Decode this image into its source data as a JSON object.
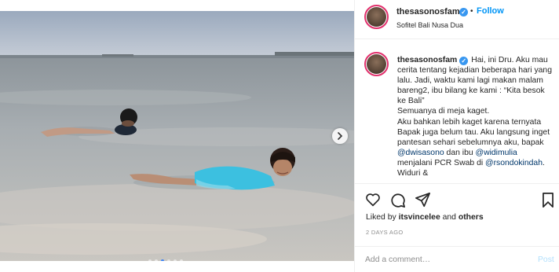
{
  "photo": {
    "alt_icon": "beach-photo",
    "carousel_dots": 6,
    "active_dot": 2
  },
  "header": {
    "username": "thesasonosfam",
    "follow_label": "Follow",
    "bullet": "•",
    "location": "Sofitel Bali Nusa Dua"
  },
  "caption": {
    "username": "thesasonosfam",
    "text1": "Hai, ini Dru. Aku mau cerita tentang kejadian beberapa hari yang lalu. Jadi, waktu kami lagi makan malam bareng2, ibu bilang ke kami : “Kita besok ke Bali”",
    "text2": "Semuanya di meja kaget.",
    "text3": "Aku bahkan lebih kaget karena ternyata Bapak juga belum tau. Aku langsung inget pantesan sehari sebelumnya aku, bapak ",
    "mention1": "@dwisasono",
    "text4": " dan ibu ",
    "mention2": "@widimulia",
    "text5": " menjalani PCR Swab di ",
    "mention3": "@rsondokindah",
    "text6": ". Widuri &"
  },
  "actions": {
    "icons": [
      "heart-icon",
      "comment-icon",
      "share-icon",
      "bookmark-icon"
    ]
  },
  "likes": {
    "prefix": "Liked by ",
    "user": "itsvincelee",
    "middle": " and ",
    "others": "others"
  },
  "timestamp": "2 DAYS AGO",
  "comment": {
    "placeholder": "Add a comment…",
    "post_label": "Post"
  },
  "colors": {
    "accent": "#0095f6",
    "verified": "#3897f0",
    "mention": "#00376b",
    "muted": "#8e8e8e",
    "post_disabled": "#b2dffc"
  }
}
